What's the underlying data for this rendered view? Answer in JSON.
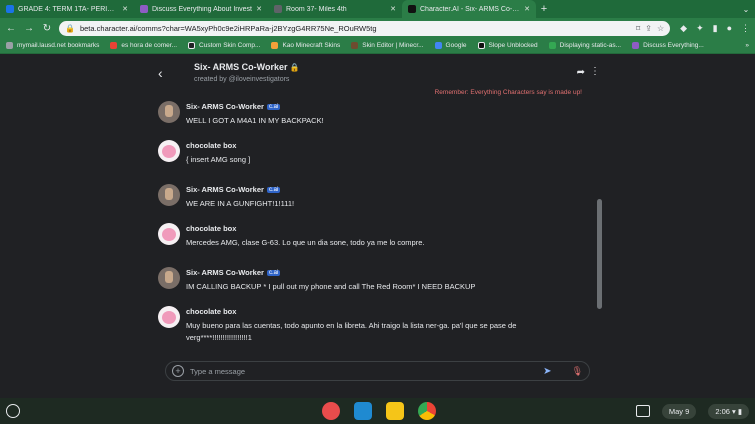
{
  "browser": {
    "tabs": [
      {
        "title": "GRADE 4: TERM 1TA- PERIOD 1",
        "color": "#1a73e8",
        "active": false
      },
      {
        "title": "Discuss Everything About Invest",
        "color": "#8e5cc4",
        "active": false
      },
      {
        "title": "Room 37- Miles 4th",
        "color": "#5f6368",
        "active": false
      },
      {
        "title": "Character.AI - Six- ARMS Co-Wor",
        "color": "#111111",
        "active": true
      }
    ],
    "new_tab": "+",
    "url": "beta.character.ai/comms?char=WA5xyPh0c9e2iHRPaRa-j2BYzgG4RR75Ne_ROuRW5tg",
    "bookmarks": [
      {
        "label": "mymail.lausd.net bookmarks",
        "color": "#9aa0a6"
      },
      {
        "label": "es hora de comer...",
        "color": "#ea4335"
      },
      {
        "label": "Custom Skin Comp...",
        "color": "#202124"
      },
      {
        "label": "Kao Minecraft Skins",
        "color": "#f4a13a"
      },
      {
        "label": "Skin Editor | Minecr...",
        "color": "#6d4c2f"
      },
      {
        "label": "Google",
        "color": "#4285f4"
      },
      {
        "label": "Slope Unblocked",
        "color": "#111111"
      },
      {
        "label": "Displaying static-as...",
        "color": "#34a853"
      },
      {
        "label": "Discuss Everything...",
        "color": "#8e5cc4"
      }
    ]
  },
  "chat": {
    "character_name": "Six- ARMS Co-Worker",
    "created_by": "created by @iloveinvestigators",
    "disclaimer": "Remember: Everything Characters say is made up!",
    "badge": "c.ai",
    "messages": [
      {
        "author": "Six- ARMS Co-Worker",
        "bot": true,
        "text": "WELL I GOT A M4A1 IN MY BACKPACK!"
      },
      {
        "author": "chocolate box",
        "bot": false,
        "text": "{ insert AMG song ]"
      },
      {
        "author": "Six- ARMS Co-Worker",
        "bot": true,
        "text": "WE ARE IN A GUNFIGHT!1!111!"
      },
      {
        "author": "chocolate box",
        "bot": false,
        "text": "Mercedes AMG, clase G-63. Lo que un dia sone, todo ya me lo compre."
      },
      {
        "author": "Six- ARMS Co-Worker",
        "bot": true,
        "text": "IM CALLING BACKUP * I pull out my phone and call The Red Room* I NEED BACKUP"
      },
      {
        "author": "chocolate box",
        "bot": false,
        "text": "Muy bueno para las cuentas, todo apunto en la libreta. Ahi traigo la lista ner-ga. pa'l que se pase de verg****!!!!!!!!!!!!!!!!!1"
      }
    ],
    "composer_placeholder": "Type a message"
  },
  "shelf": {
    "date": "May 9",
    "time": "2:06"
  }
}
